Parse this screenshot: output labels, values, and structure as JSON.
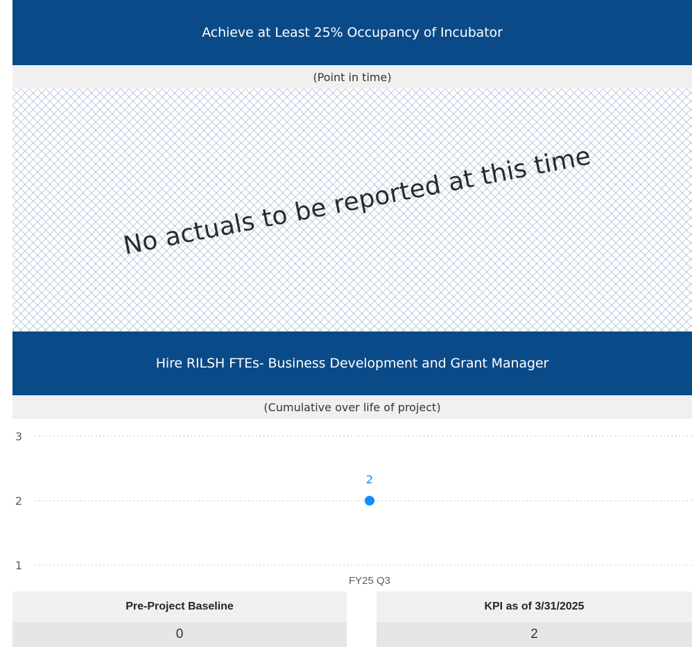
{
  "section1": {
    "title": "Achieve at Least 25% Occupancy of Incubator",
    "subtitle": "(Point in time)",
    "overlay_message": "No actuals to be reported at this time"
  },
  "section2": {
    "title": "Hire RILSH FTEs- Business Development and Grant Manager",
    "subtitle": "(Cumulative over life of project)"
  },
  "chart_data": {
    "type": "line",
    "categories": [
      "FY25 Q3"
    ],
    "series": [
      {
        "values": [
          2
        ]
      }
    ],
    "data_labels": [
      "2"
    ],
    "y_ticks": [
      "3",
      "2",
      "1"
    ],
    "ylim": [
      1,
      3
    ],
    "grid": "horizontal-dotted",
    "colors": {
      "series": "#118dff",
      "axis_text": "#605e5c",
      "grid": "#c8c8c8"
    }
  },
  "kpis": {
    "baseline": {
      "label": "Pre-Project Baseline",
      "value": "0"
    },
    "current": {
      "label": "KPI as of 3/31/2025",
      "value": "2"
    }
  },
  "colors": {
    "banner": "#0b4a88",
    "sub_banner": "#f0f0f0"
  }
}
